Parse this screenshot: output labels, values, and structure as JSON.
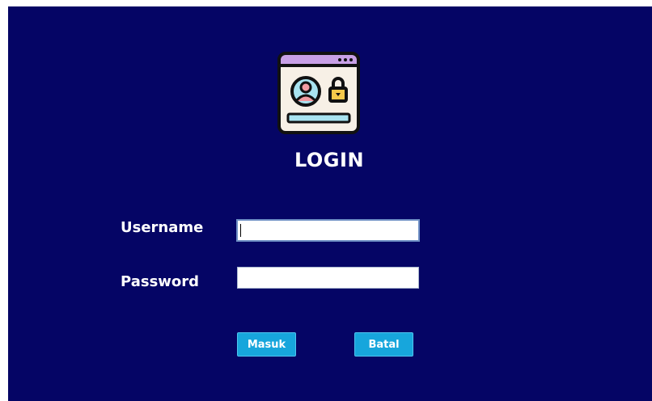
{
  "login": {
    "title": "LOGIN",
    "username_label": "Username",
    "username_value": "",
    "password_label": "Password",
    "password_value": "",
    "submit_label": "Masuk",
    "cancel_label": "Batal"
  },
  "icons": {
    "logo": "login-window-icon"
  },
  "colors": {
    "background": "#050565",
    "button": "#17a6dc",
    "text": "#ffffff"
  }
}
